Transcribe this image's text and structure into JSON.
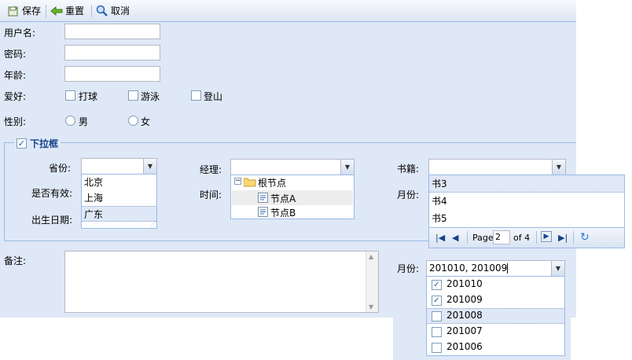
{
  "toolbar": {
    "save": "保存",
    "reset": "重置",
    "cancel": "取消"
  },
  "form": {
    "username_label": "用户名:",
    "password_label": "密码:",
    "age_label": "年龄:",
    "hobby_label": "爱好:",
    "hobbies": [
      "打球",
      "游泳",
      "登山"
    ],
    "gender_label": "性别:",
    "genders": [
      "男",
      "女"
    ]
  },
  "dropdown_section": {
    "legend": "下拉框",
    "province_label": "省份:",
    "provinces": [
      "北京",
      "上海",
      "广东"
    ],
    "valid_label": "是否有效:",
    "birth_label": "出生日期:",
    "manager_label": "经理:",
    "time_label": "时间:",
    "tree": {
      "root": "根节点",
      "nodes": [
        "节点A",
        "节点B"
      ]
    },
    "books_label": "书籍:",
    "month_label": "月份:",
    "books": [
      "书3",
      "书4",
      "书5"
    ],
    "pager": {
      "page_word": "Page",
      "page_value": "2",
      "of_text": "of 4"
    }
  },
  "remark_label": "备注:",
  "month2": {
    "label": "月份:",
    "value": "201010, 201009",
    "options": [
      {
        "text": "201010",
        "checked": true
      },
      {
        "text": "201009",
        "checked": true
      },
      {
        "text": "201008",
        "checked": false
      },
      {
        "text": "201007",
        "checked": false
      },
      {
        "text": "201006",
        "checked": false
      }
    ]
  }
}
